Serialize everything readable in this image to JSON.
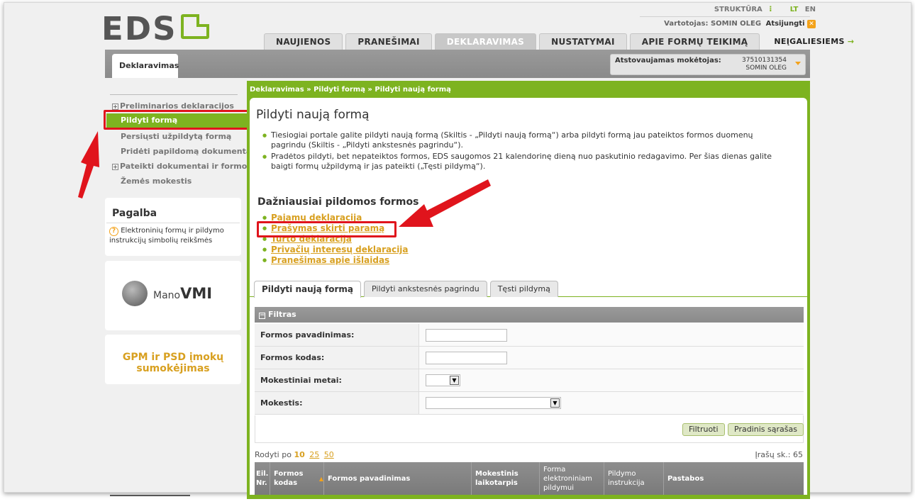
{
  "header": {
    "logo_text": "EDS",
    "struktura": "STRUKTŪRA",
    "lang_lt": "LT",
    "lang_en": "EN",
    "user_line": "Vartotojas: SOMIN OLEG",
    "logout": "Atsijungti"
  },
  "nav": {
    "tabs": [
      "NAUJIENOS",
      "PRANEŠIMAI",
      "DEKLARAVIMAS",
      "NUSTATYMAI",
      "APIE FORMŲ TEIKIMĄ"
    ],
    "active": "DEKLARAVIMAS",
    "noreg": "NEĮGALIESIEMS",
    "noreg_arrow": "→"
  },
  "subheader": {
    "section_tab": "Deklaravimas",
    "payer_label": "Atstovaujamas mokėtojas:",
    "payer_code": "37510131354",
    "payer_name": "SOMIN OLEG"
  },
  "sidebar": {
    "items": [
      {
        "label": "Preliminarios deklaracijos",
        "expandable": true
      },
      {
        "label": "Pildyti formą",
        "active": true
      },
      {
        "label": "Persiųsti užpildytą formą"
      },
      {
        "label": "Pridėti papildomą dokumentą"
      },
      {
        "label": "Pateikti dokumentai ir formos",
        "expandable": true
      },
      {
        "label": "Žemės mokestis"
      }
    ],
    "help_title": "Pagalba",
    "help_text": "Elektroninių formų ir pildymo instrukcijų simbolių reikšmės",
    "mano_prefix": "Mano",
    "mano_suffix": "VMI",
    "gpm_text": "GPM ir PSD įmokų sumokėjimas"
  },
  "main": {
    "breadcrumb": "Deklaravimas » Pildyti formą » Pildyti naują formą",
    "title": "Pildyti naują formą",
    "bullets": [
      "Tiesiogiai portale galite pildyti naują formą (Skiltis - „Pildyti naują formą“) arba pildyti formą jau pateiktos formos duomenų pagrindu (Skiltis - „Pildyti ankstesnės pagrindu“).",
      "Pradėtos pildyti, bet nepateiktos formos, EDS saugomos 21 kalendorinę dieną nuo paskutinio redagavimo. Per šias dienas galite baigti formų užpildymą ir jas pateikti („Tęsti pildymą“)."
    ],
    "frequent_title": "Dažniausiai pildomos formos",
    "frequent": [
      "Pajamų deklaracija",
      "Prašymas skirti paramą",
      "Turto deklaracija",
      "Privačių interesų deklaracija",
      "Pranešimas apie išlaidas"
    ],
    "form_tabs": [
      "Pildyti naują formą",
      "Pildyti ankstesnės pagrindu",
      "Tęsti pildymą"
    ],
    "filter": {
      "title": "Filtras",
      "fields": [
        {
          "label": "Formos pavadinimas:",
          "value": ""
        },
        {
          "label": "Formos kodas:",
          "value": ""
        },
        {
          "label": "Mokestiniai metai:",
          "value": ""
        },
        {
          "label": "Mokestis:",
          "value": ""
        }
      ],
      "btn_filter": "Filtruoti",
      "btn_reset": "Pradinis sąrašas"
    },
    "shown_label": "Rodyti po",
    "page_sizes": [
      "10",
      "25",
      "50"
    ],
    "count_label": "Įrašų sk.: 65",
    "table_headers": [
      "Eil. Nr.",
      "Formos kodas",
      "Formos pavadinimas",
      "Mokestinis laikotarpis",
      "Forma elektroniniam pildymui",
      "Pildymo instrukcija",
      "Pastabos"
    ]
  },
  "colors": {
    "brand_green": "#7db320",
    "accent_orange": "#f3a21b",
    "link_gold": "#d8a020",
    "annotation_red": "#e0141c"
  }
}
